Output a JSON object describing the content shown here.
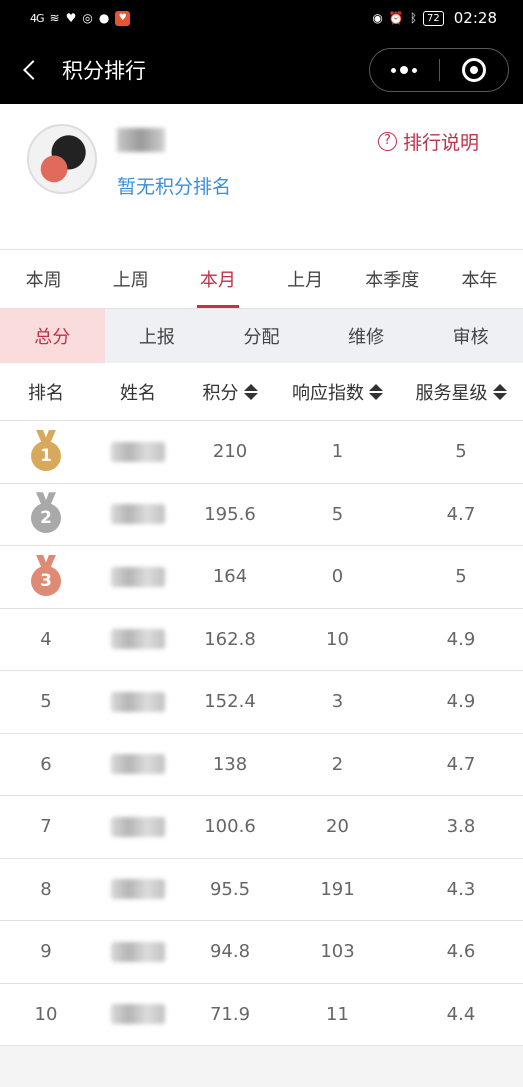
{
  "status_bar": {
    "signal": "4G",
    "battery": "72",
    "time": "02:28"
  },
  "nav": {
    "title": "积分排行"
  },
  "profile": {
    "no_rank_text": "暂无积分排名",
    "explain_label": "排行说明",
    "help_glyph": "?"
  },
  "period_tabs": [
    {
      "label": "本周",
      "active": false
    },
    {
      "label": "上周",
      "active": false
    },
    {
      "label": "本月",
      "active": true
    },
    {
      "label": "上月",
      "active": false
    },
    {
      "label": "本季度",
      "active": false
    },
    {
      "label": "本年",
      "active": false
    }
  ],
  "category_tabs": [
    {
      "label": "总分",
      "active": true
    },
    {
      "label": "上报",
      "active": false
    },
    {
      "label": "分配",
      "active": false
    },
    {
      "label": "维修",
      "active": false
    },
    {
      "label": "审核",
      "active": false
    }
  ],
  "table": {
    "headers": [
      "排名",
      "姓名",
      "积分",
      "响应指数",
      "服务星级"
    ],
    "rows": [
      {
        "rank": "1",
        "score": "210",
        "response": "1",
        "stars": "5",
        "medal": "gold"
      },
      {
        "rank": "2",
        "score": "195.6",
        "response": "5",
        "stars": "4.7",
        "medal": "silver"
      },
      {
        "rank": "3",
        "score": "164",
        "response": "0",
        "stars": "5",
        "medal": "bronze"
      },
      {
        "rank": "4",
        "score": "162.8",
        "response": "10",
        "stars": "4.9"
      },
      {
        "rank": "5",
        "score": "152.4",
        "response": "3",
        "stars": "4.9"
      },
      {
        "rank": "6",
        "score": "138",
        "response": "2",
        "stars": "4.7"
      },
      {
        "rank": "7",
        "score": "100.6",
        "response": "20",
        "stars": "3.8"
      },
      {
        "rank": "8",
        "score": "95.5",
        "response": "191",
        "stars": "4.3"
      },
      {
        "rank": "9",
        "score": "94.8",
        "response": "103",
        "stars": "4.6"
      },
      {
        "rank": "10",
        "score": "71.9",
        "response": "11",
        "stars": "4.4"
      }
    ]
  },
  "colors": {
    "accent": "#c0314a",
    "link": "#3d8fd6",
    "gold": "#d9a95b",
    "silver": "#a9a9a9",
    "bronze": "#de8a74"
  }
}
